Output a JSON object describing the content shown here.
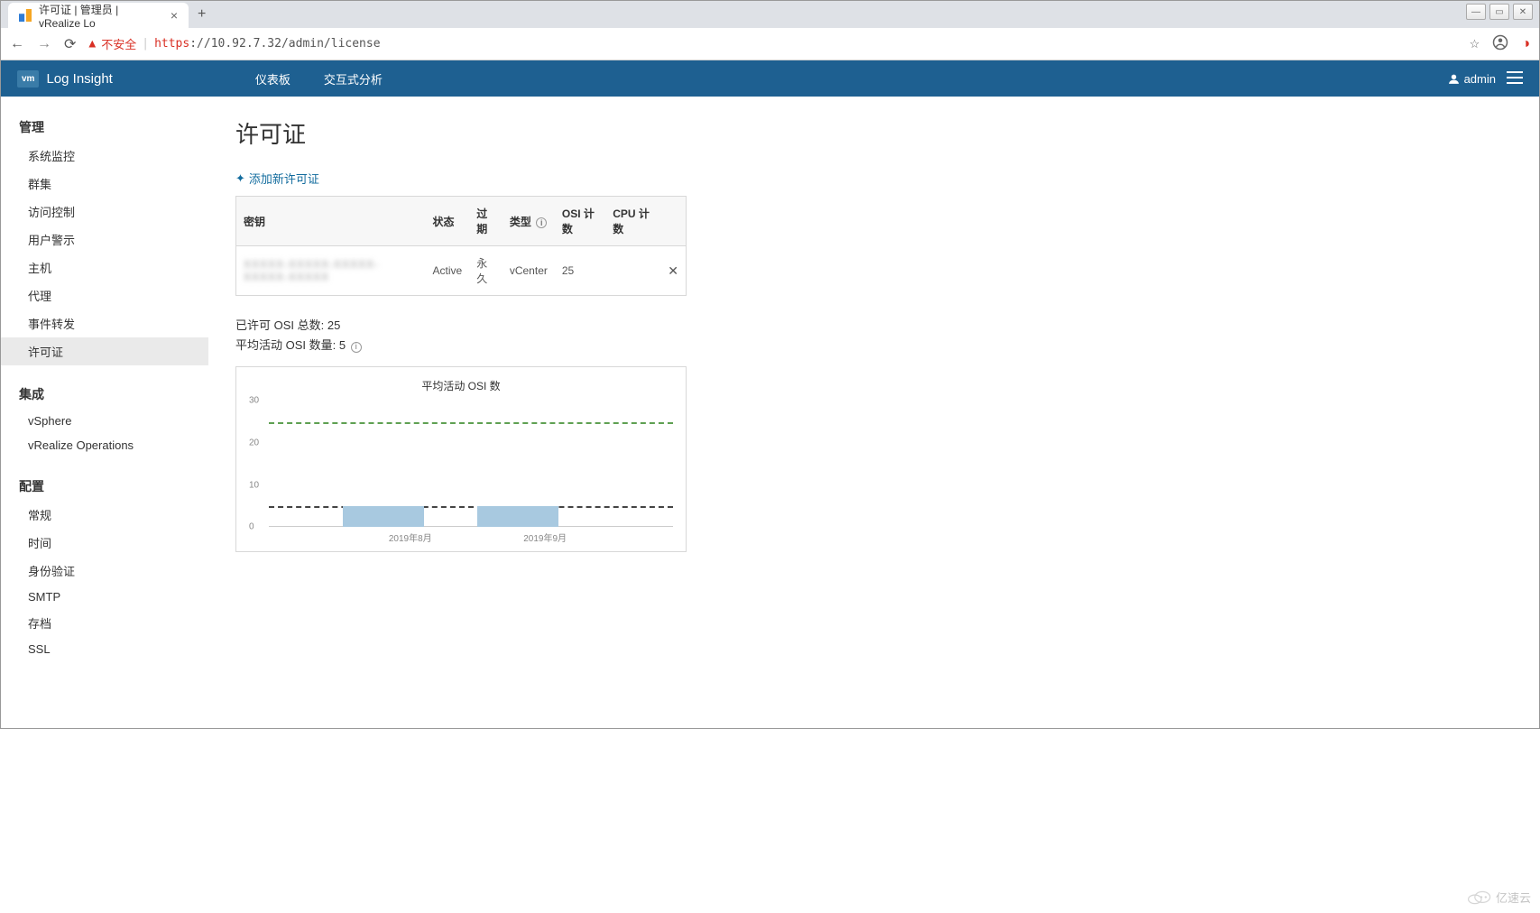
{
  "browser": {
    "tab_title": "许可证 | 管理员 | vRealize Lo",
    "url_unsafe_label": "不安全",
    "url_https": "https",
    "url_rest": "://10.92.7.32/admin/license"
  },
  "header": {
    "brand": "Log Insight",
    "nav": {
      "dashboard": "仪表板",
      "interactive": "交互式分析"
    },
    "user": "admin"
  },
  "sidebar": {
    "sections": {
      "manage": {
        "title": "管理",
        "items": [
          "系统监控",
          "群集",
          "访问控制",
          "用户警示",
          "主机",
          "代理",
          "事件转发",
          "许可证"
        ]
      },
      "integrate": {
        "title": "集成",
        "items": [
          "vSphere",
          "vRealize Operations"
        ]
      },
      "config": {
        "title": "配置",
        "items": [
          "常规",
          "时间",
          "身份验证",
          "SMTP",
          "存档",
          "SSL"
        ]
      }
    }
  },
  "page": {
    "title": "许可证",
    "add_link": "添加新许可证",
    "table": {
      "headers": {
        "key": "密钥",
        "status": "状态",
        "expire": "过期",
        "type": "类型",
        "osi": "OSI 计数",
        "cpu": "CPU 计数"
      },
      "row": {
        "key": "XXXXX-XXXXX-XXXXX-XXXXX-XXXXX",
        "status": "Active",
        "expire": "永久",
        "type": "vCenter",
        "osi": "25",
        "cpu": ""
      }
    },
    "summary": {
      "licensed_label": "已许可 OSI 总数:",
      "licensed_value": "25",
      "avg_label": "平均活动 OSI 数量:",
      "avg_value": "5"
    }
  },
  "chart_data": {
    "type": "bar",
    "title": "平均活动 OSI 数",
    "categories": [
      "2019年8月",
      "2019年9月"
    ],
    "values": [
      5,
      5
    ],
    "threshold": 25,
    "avg_line": 5,
    "ylim": [
      0,
      30
    ],
    "yticks": [
      0,
      10,
      20,
      30
    ],
    "ylabel": "",
    "xlabel": ""
  },
  "watermark": "亿速云"
}
